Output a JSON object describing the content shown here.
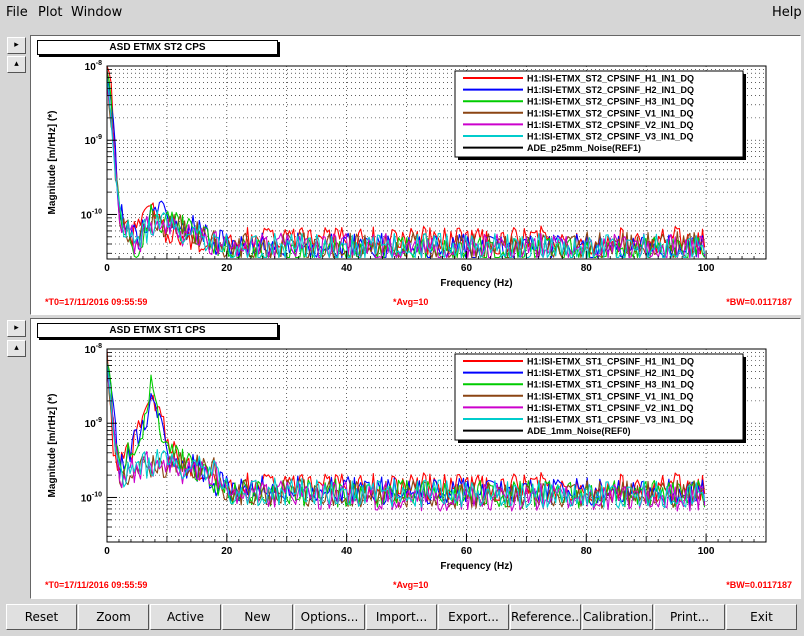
{
  "menu": {
    "file": "File",
    "plot": "Plot",
    "window": "Window",
    "help": "Help"
  },
  "side_buttons": {
    "expand": "▸",
    "collapse": "▴"
  },
  "plots": [
    {
      "title": "ASD ETMX ST2 CPS",
      "footer": {
        "t0": "*T0=17/11/2016 09:55:59",
        "avg": "*Avg=10",
        "bw": "*BW=0.0117187"
      }
    },
    {
      "title": "ASD ETMX ST1 CPS",
      "footer": {
        "t0": "*T0=17/11/2016 09:55:59",
        "avg": "*Avg=10",
        "bw": "*BW=0.0117187"
      }
    }
  ],
  "chart_data": [
    {
      "type": "line",
      "title": "ASD ETMX ST2 CPS",
      "xlabel": "Frequency (Hz)",
      "ylabel": "Magnitude [m/rtHz] (*)",
      "xlim": [
        0,
        110
      ],
      "ylim_log10": [
        -10.6,
        -8
      ],
      "x_ticks": [
        0,
        20,
        40,
        60,
        80,
        100
      ],
      "y_ticks": [
        {
          "label": "10",
          "exp": "-8",
          "value": 1e-08
        },
        {
          "label": "10",
          "exp": "-9",
          "value": 1e-09
        },
        {
          "label": "10",
          "exp": "-10",
          "value": 1e-10
        }
      ],
      "grid": true,
      "legend_position": "top-right",
      "series": [
        {
          "name": "H1:ISI-ETMX_ST2_CPSINF_H1_IN1_DQ",
          "color": "#ff0000",
          "floor": 4.5e-11,
          "x": [
            0,
            0.5,
            1,
            2,
            3,
            5,
            7.5,
            9,
            12,
            20,
            40,
            60,
            80,
            100
          ],
          "y": [
            1e-08,
            8e-09,
            2e-09,
            1.5e-10,
            6e-11,
            5e-11,
            1.8e-10,
            6e-11,
            4.8e-11,
            4.6e-11,
            4.5e-11,
            4.5e-11,
            4.5e-11,
            4.5e-11
          ]
        },
        {
          "name": "H1:ISI-ETMX_ST2_CPSINF_H2_IN1_DQ",
          "color": "#0000ff",
          "floor": 3.6e-11,
          "x": [
            0,
            1,
            2,
            5,
            7.5,
            20,
            60,
            100
          ],
          "y": [
            9e-09,
            1.5e-09,
            1.2e-10,
            4e-11,
            1.2e-10,
            3.7e-11,
            3.6e-11,
            3.6e-11
          ]
        },
        {
          "name": "H1:ISI-ETMX_ST2_CPSINF_H3_IN1_DQ",
          "color": "#00cc00",
          "floor": 3.2e-11,
          "x": [
            0,
            1,
            2,
            5,
            7.5,
            20,
            60,
            100
          ],
          "y": [
            9e-09,
            1.4e-09,
            1.1e-10,
            3.5e-11,
            1e-10,
            3.3e-11,
            3.2e-11,
            3.2e-11
          ]
        },
        {
          "name": "H1:ISI-ETMX_ST2_CPSINF_V1_IN1_DQ",
          "color": "#8b4513",
          "floor": 3.8e-11,
          "x": [
            0,
            1,
            2,
            5,
            7.5,
            20,
            60,
            100
          ],
          "y": [
            8e-09,
            1.2e-09,
            1e-10,
            4e-11,
            9e-11,
            3.8e-11,
            3.8e-11,
            3.8e-11
          ]
        },
        {
          "name": "H1:ISI-ETMX_ST2_CPSINF_V2_IN1_DQ",
          "color": "#cc00cc",
          "floor": 3.6e-11,
          "x": [
            0,
            1,
            2,
            5,
            7.5,
            20,
            60,
            100
          ],
          "y": [
            8e-09,
            1.2e-09,
            1e-10,
            3.8e-11,
            8e-11,
            3.6e-11,
            3.6e-11,
            3.6e-11
          ]
        },
        {
          "name": "H1:ISI-ETMX_ST2_CPSINF_V3_IN1_DQ",
          "color": "#00cccc",
          "floor": 3.6e-11,
          "x": [
            0,
            1,
            2,
            5,
            7.5,
            20,
            60,
            100
          ],
          "y": [
            8e-09,
            1.2e-09,
            1e-10,
            3.8e-11,
            8e-11,
            3.6e-11,
            3.6e-11,
            3.6e-11
          ]
        },
        {
          "name": "ADE_p25mm_Noise(REF1)",
          "color": "#000000",
          "floor": null,
          "x": [],
          "y": []
        }
      ]
    },
    {
      "type": "line",
      "title": "ASD ETMX ST1 CPS",
      "xlabel": "Frequency (Hz)",
      "ylabel": "Magnitude [m/rtHz] (*)",
      "xlim": [
        0,
        110
      ],
      "ylim_log10": [
        -10.6,
        -8
      ],
      "x_ticks": [
        0,
        20,
        40,
        60,
        80,
        100
      ],
      "y_ticks": [
        {
          "label": "10",
          "exp": "-8",
          "value": 1e-08
        },
        {
          "label": "10",
          "exp": "-9",
          "value": 1e-09
        },
        {
          "label": "10",
          "exp": "-10",
          "value": 1e-10
        }
      ],
      "grid": true,
      "legend_position": "top-right",
      "series": [
        {
          "name": "H1:ISI-ETMX_ST1_CPSINF_H1_IN1_DQ",
          "color": "#ff0000",
          "floor": 1.4e-10,
          "x": [
            0,
            1,
            2,
            4,
            6,
            7.5,
            9,
            12,
            16,
            20,
            30,
            60,
            100
          ],
          "y": [
            9e-09,
            4e-10,
            3e-10,
            4e-10,
            1e-09,
            3e-09,
            1e-09,
            3e-10,
            2.5e-10,
            1.5e-10,
            1.4e-10,
            1.4e-10,
            1.4e-10
          ]
        },
        {
          "name": "H1:ISI-ETMX_ST1_CPSINF_H2_IN1_DQ",
          "color": "#0000ff",
          "floor": 1.2e-10,
          "x": [
            0,
            2,
            6,
            7.5,
            10,
            20,
            60,
            100
          ],
          "y": [
            8e-09,
            2.5e-10,
            8e-10,
            2.5e-09,
            4e-10,
            1.3e-10,
            1.2e-10,
            1.2e-10
          ]
        },
        {
          "name": "H1:ISI-ETMX_ST1_CPSINF_H3_IN1_DQ",
          "color": "#00cc00",
          "floor": 1.1e-10,
          "x": [
            0,
            2,
            6,
            7.5,
            10,
            20,
            60,
            100
          ],
          "y": [
            7e-09,
            2.5e-10,
            9e-10,
            3.5e-09,
            4e-10,
            1.2e-10,
            1.1e-10,
            1.1e-10
          ]
        },
        {
          "name": "H1:ISI-ETMX_ST1_CPSINF_V1_IN1_DQ",
          "color": "#8b4513",
          "floor": 1.1e-10,
          "x": [
            0,
            2,
            8,
            14,
            18,
            20,
            60,
            100
          ],
          "y": [
            7e-09,
            2e-10,
            3e-10,
            2.5e-10,
            2.5e-10,
            1.2e-10,
            1.1e-10,
            1.1e-10
          ]
        },
        {
          "name": "H1:ISI-ETMX_ST1_CPSINF_V2_IN1_DQ",
          "color": "#cc00cc",
          "floor": 1e-10,
          "x": [
            0,
            2,
            8,
            14,
            18,
            20,
            60,
            100
          ],
          "y": [
            7e-09,
            2e-10,
            3e-10,
            2.2e-10,
            2.2e-10,
            1.1e-10,
            1e-10,
            1e-10
          ]
        },
        {
          "name": "H1:ISI-ETMX_ST1_CPSINF_V3_IN1_DQ",
          "color": "#00cccc",
          "floor": 1.1e-10,
          "x": [
            0,
            2,
            8,
            14,
            18,
            20,
            60,
            100
          ],
          "y": [
            7e-09,
            2e-10,
            3e-10,
            2.4e-10,
            2.4e-10,
            1.2e-10,
            1.1e-10,
            1.1e-10
          ]
        },
        {
          "name": "ADE_1mm_Noise(REF0)",
          "color": "#000000",
          "floor": null,
          "x": [],
          "y": []
        }
      ]
    }
  ],
  "buttons": [
    "Reset",
    "Zoom",
    "Active",
    "New",
    "Options...",
    "Import...",
    "Export...",
    "Reference...",
    "Calibration...",
    "Print...",
    "Exit"
  ]
}
